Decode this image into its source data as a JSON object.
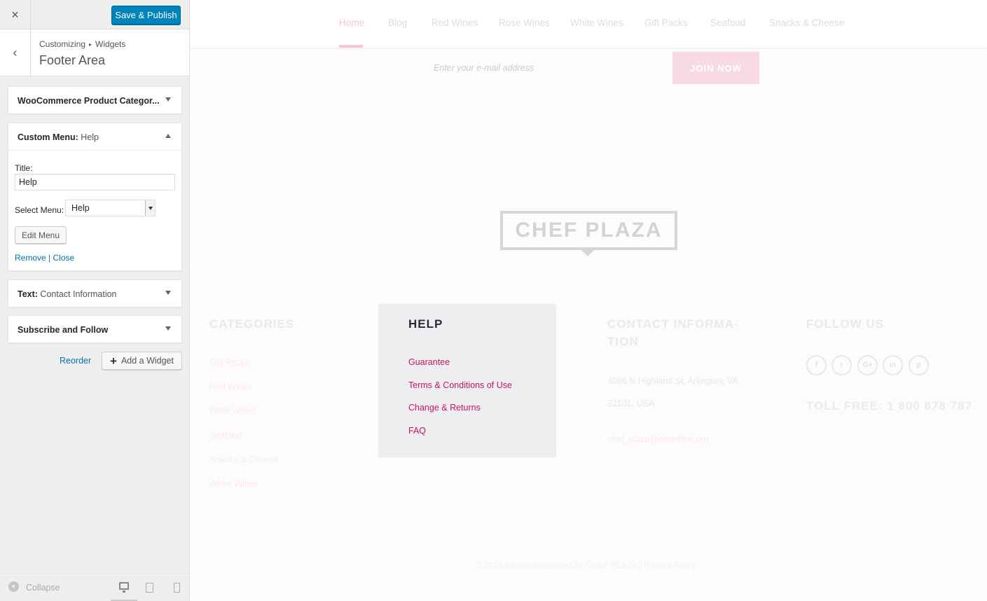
{
  "sidebar": {
    "close_icon": "×",
    "publish_label": "Save & Publish",
    "back_icon": "‹",
    "breadcrumb": {
      "root": "Customizing",
      "separator": "▸",
      "current": "Widgets"
    },
    "section_title": "Footer Area",
    "widgets": {
      "products": {
        "title": "WooCommerce Product Categor..."
      },
      "help": {
        "type": "Custom Menu:",
        "name": "Help",
        "title_label": "Title:",
        "title_value": "Help",
        "select_label": "Select Menu:",
        "select_value": "Help",
        "edit_menu_label": "Edit Menu",
        "remove_label": "Remove",
        "link_separator": "|",
        "close_label": "Close"
      },
      "text": {
        "type": "Text:",
        "name": "Contact Information"
      },
      "subscribe": {
        "title": "Subscribe and Follow"
      }
    },
    "reorder_label": "Reorder",
    "add_widget_icon": "+",
    "add_widget_label": "Add a Widget",
    "collapse_label": "Collapse",
    "icons": [
      "close-icon",
      "back-icon",
      "arrow-down-icon",
      "arrow-up-icon",
      "plus-icon",
      "collapse-icon",
      "desktop-icon",
      "tablet-icon",
      "mobile-icon"
    ]
  },
  "preview": {
    "nav": [
      "Home",
      "Blog",
      "Red Wines",
      "Rose Wines",
      "White Wines",
      "Gift Packs",
      "Seafood",
      "Snacks & Cheese"
    ],
    "active_nav": "Home",
    "email_placeholder": "Enter your e-mail address",
    "join_label": "JOIN NOW",
    "logo_text": "CHEF PLAZA",
    "categories": {
      "heading": "CATEGORIES",
      "items": [
        "Gift Packs",
        "Red Wines",
        "Rose Wines",
        "Seafood",
        "Snacks & Cheese",
        "White Wines"
      ]
    },
    "help": {
      "heading": "HELP",
      "items": [
        "Guarantee",
        "Terms & Conditions of Use",
        "Change & Returns",
        "FAQ"
      ]
    },
    "contact": {
      "heading_line1": "CONTACT INFORMA-",
      "heading_line2": "TION",
      "address1": "4096 N Highland St, Arlington, VA",
      "address2": "32101, USA",
      "email": "chef_plaza@demolink.org"
    },
    "follow": {
      "heading": "FOLLOW US",
      "social": [
        "f",
        "t",
        "G+",
        "in",
        "p"
      ],
      "social_icons": [
        "facebook-icon",
        "twitter-icon",
        "google-plus-icon",
        "linkedin-icon",
        "pinterest-icon"
      ],
      "toll_free": "TOLL FREE: 1 800 878 787"
    },
    "copyright": "© 2016 All rights reserved by CHEF PLAZA |",
    "privacy": "Privacy Policy"
  },
  "colors": {
    "publish_blue": "#0085ba",
    "link_blue": "#0073aa",
    "help_link": "#c2185b",
    "nav_active": "#f6c7d4",
    "join_button": "#f8dae3"
  }
}
